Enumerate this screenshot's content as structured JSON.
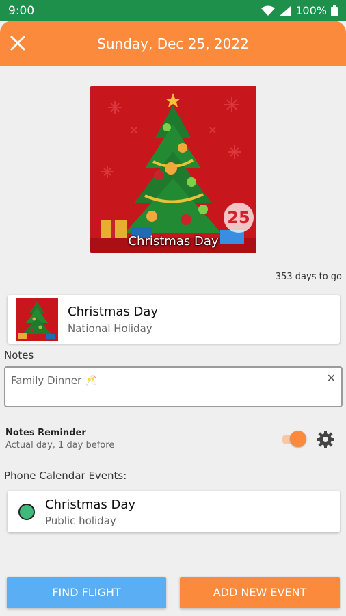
{
  "status_bar": {
    "time": "9:00",
    "battery": "100%",
    "icons": [
      "wifi-icon",
      "signal-icon",
      "battery-icon"
    ]
  },
  "header": {
    "title": "Sunday, Dec 25, 2022",
    "close_icon": "close-icon"
  },
  "hero": {
    "caption": "Christmas Day",
    "day_badge": "25"
  },
  "countdown": "353 days to go",
  "event": {
    "name": "Christmas Day",
    "type": "National Holiday"
  },
  "notes": {
    "label": "Notes",
    "value": "Family Dinner 🥂"
  },
  "reminder": {
    "title": "Notes Reminder",
    "subtitle": "Actual day, 1 day before",
    "enabled": true
  },
  "phone_calendar": {
    "label": "Phone Calendar Events:",
    "events": [
      {
        "name": "Christmas Day",
        "type": "Public holiday",
        "color": "#3fba7b"
      }
    ]
  },
  "actions": {
    "find_flight": "FIND FLIGHT",
    "add_event": "ADD NEW EVENT"
  },
  "colors": {
    "status_bar": "#1f8f4c",
    "accent": "#fb8a3c",
    "flight_button": "#5aaef3",
    "hero_background": "#c8161d"
  }
}
